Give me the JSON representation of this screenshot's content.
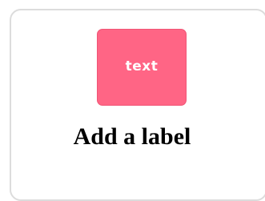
{
  "card": {
    "tag": {
      "text": "text",
      "color": "#ff6585"
    },
    "label": "Add a label"
  }
}
